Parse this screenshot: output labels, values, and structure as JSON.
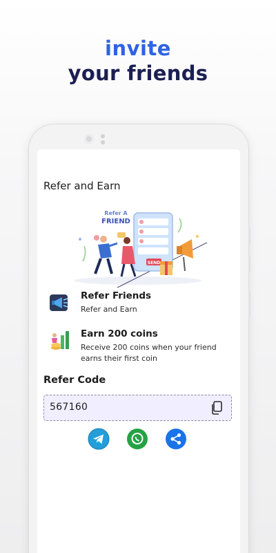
{
  "promo": {
    "line1": "invite",
    "line2": "your friends"
  },
  "screen": {
    "title": "Refer and Earn",
    "illustration": {
      "sign_line1": "Refer A",
      "sign_line2": "FRIEND",
      "send_label": "SEND"
    },
    "items": [
      {
        "icon": "megaphone-icon",
        "title": "Refer Friends",
        "description": "Refer and Earn"
      },
      {
        "icon": "coins-growth-icon",
        "title": "Earn 200 coins",
        "description": "Receive 200 coins when your friend earns their first coin"
      }
    ],
    "refer_code": {
      "label": "Refer Code",
      "value": "567160"
    },
    "share": [
      {
        "icon": "telegram-icon",
        "color": "#229ed9"
      },
      {
        "icon": "whatsapp-icon",
        "color": "#25a244"
      },
      {
        "icon": "share-icon",
        "color": "#1a73e8"
      }
    ]
  }
}
